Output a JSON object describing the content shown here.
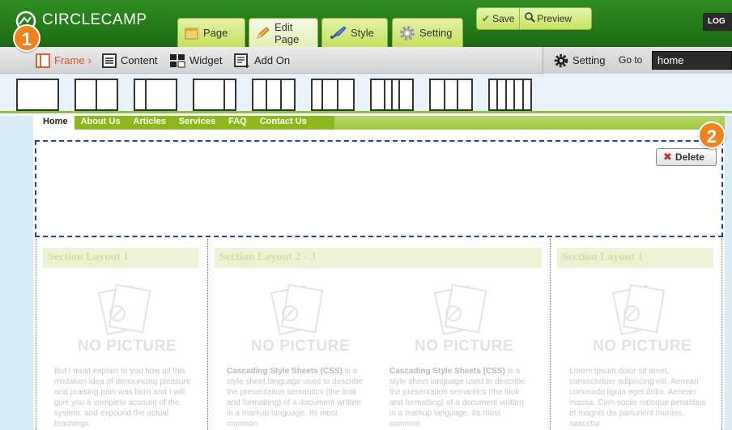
{
  "app": {
    "logo": "CIRCLECAMP",
    "log_button": "LOG"
  },
  "badges": [
    "1",
    "2"
  ],
  "tabs": [
    {
      "label": "Page",
      "icon": "notepad-icon"
    },
    {
      "label": "Edit Page",
      "icon": "pencil-icon"
    },
    {
      "label": "Style",
      "icon": "paintbrush-icon"
    },
    {
      "label": "Setting",
      "icon": "gear-icon"
    }
  ],
  "actions": {
    "save": "Save",
    "preview": "Preview"
  },
  "toolbar": {
    "frame": "Frame",
    "content": "Content",
    "widget": "Widget",
    "add_on": "Add On",
    "setting": "Setting",
    "goto_label": "Go to",
    "goto_value": "home"
  },
  "frame_layouts": [
    1,
    2,
    2,
    2,
    3,
    3,
    4,
    3,
    4
  ],
  "nav": [
    "Home",
    "About Us",
    "Articles",
    "Services",
    "FAQ",
    "Contact Us"
  ],
  "nav_active": "Home",
  "dropzone": {
    "delete_label": "Delete"
  },
  "sections": [
    {
      "title": "Section Layout 1"
    },
    {
      "title": "Section Layout 2 - 3"
    },
    {
      "title": "Section Layout 1"
    }
  ],
  "placeholder_label": "NO PICTURE",
  "paragraphs": [
    "But I must explain to you how all this mistaken idea of denouncing pleasure and praising pain was born and I will give you a complete account of the system, and expound the actual teachings",
    "is a style sheet language used to describe the presentation semantics (the look and formatting) of a document written in a markup language. Its most common",
    "is a style sheet language used to describe the presentation semantics (the look and formatting) of a document written in a markup language. Its most common",
    "Lorem ipsum dolor sit amet, consectetuer adipiscing elit. Aenean commodo ligula eget dolor. Aenean massa. Cum sociis natoque penatibus et magnis dis parturient montes, nascetur"
  ],
  "css_term": "Cascading Style Sheets (CSS)",
  "colors": {
    "topbar": "#2f8e22",
    "tab_green": "#c4df5b",
    "badge_orange": "#f0831e",
    "dropzone_border": "#1a3ccf",
    "nav_green": "#8cb81e"
  }
}
